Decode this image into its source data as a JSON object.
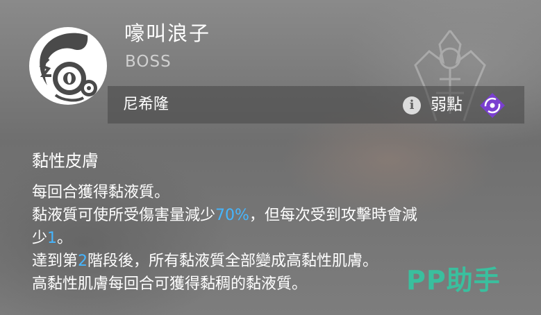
{
  "boss": {
    "name": "嚎叫浪子",
    "type": "BOSS",
    "origin": "尼希隆",
    "emblem_icon": "monster-emblem-icon",
    "info_icon": "info-icon",
    "info_glyph": "i",
    "weakness_label": "弱點",
    "weakness_icon": "purple-element-weakness-icon"
  },
  "skill": {
    "title": "黏性皮膚",
    "lines": [
      {
        "a": "每回合獲得黏液質。"
      },
      {
        "a": "黏液質可使所受傷害量減少",
        "hl": "70%",
        "b": "，但每次受到攻擊時會減"
      },
      {
        "a": "少",
        "hl": "1",
        "b": "。"
      },
      {
        "a": "達到第",
        "hl": "2",
        "b": "階段後，所有黏液質全部變成高黏性肌膚。"
      },
      {
        "a": "高黏性肌膚每回合可獲得黏稠的黏液質。"
      }
    ]
  },
  "watermark": "PP助手",
  "colors": {
    "highlight": "#46b6ff",
    "weakness_purple": "#7a3fd0",
    "watermark": "#37c3a0",
    "text": "#ffffff"
  }
}
